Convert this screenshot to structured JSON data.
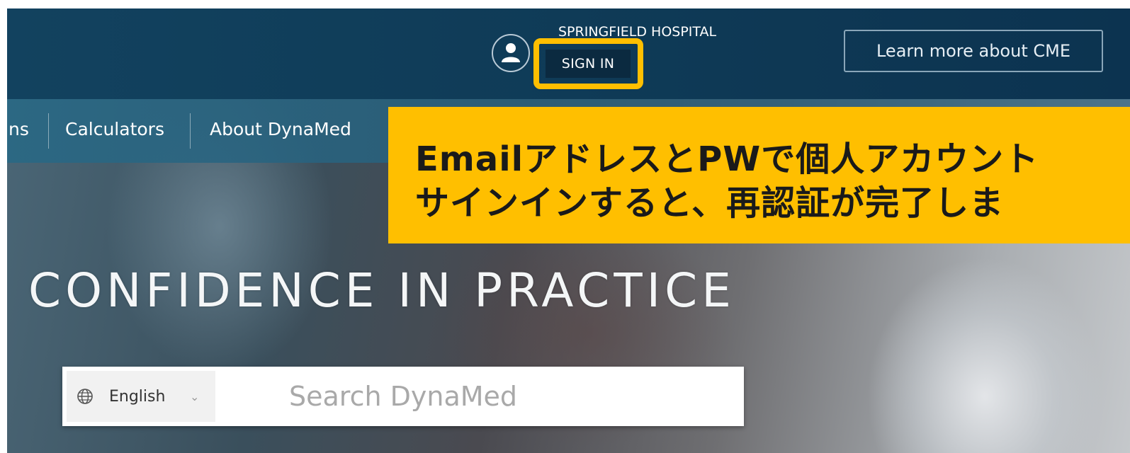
{
  "header": {
    "org_name": "SPRINGFIELD HOSPITAL",
    "sign_in_label": "SIGN IN",
    "cme_button_label": "Learn more about CME"
  },
  "nav": {
    "items": [
      {
        "label": "ns"
      },
      {
        "label": "Calculators"
      },
      {
        "label": "About DynaMed"
      }
    ]
  },
  "annotation": {
    "line1": "EmailアドレスとPWで個人アカウント",
    "line2": "サインインすると、再認証が完了しま",
    "color": "#ffbf00"
  },
  "hero": {
    "title": "CONFIDENCE IN PRACTICE"
  },
  "search": {
    "language_label": "English",
    "placeholder": "Search DynaMed",
    "icon_color": "#e8771e"
  },
  "icons": {
    "avatar": "user-icon",
    "globe": "globe-icon",
    "chevron": "chevron-down-icon",
    "search": "search-icon"
  }
}
